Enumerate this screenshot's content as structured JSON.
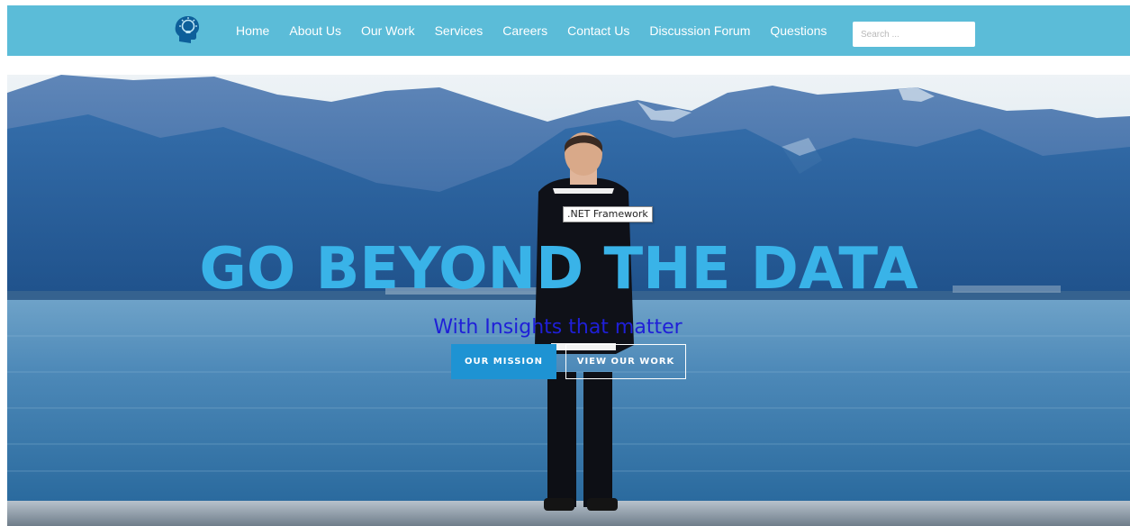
{
  "nav": {
    "logo_icon": "head-lightbulb-icon",
    "links": [
      "Home",
      "About Us",
      "Our Work",
      "Services",
      "Careers",
      "Contact Us",
      "Discussion Forum",
      "Questions"
    ],
    "search_placeholder": "Search ..."
  },
  "hero": {
    "tooltip": ".NET Framework",
    "title": "GO BEYOND THE DATA",
    "subtitle": "With Insights that matter",
    "primary_button": "OUR MISSION",
    "secondary_button": "VIEW OUR WORK"
  },
  "colors": {
    "navbar": "#5bbcd8",
    "title": "#39b3e8",
    "subtitle": "#1f1fd8",
    "primary_button": "#1e93d3"
  }
}
